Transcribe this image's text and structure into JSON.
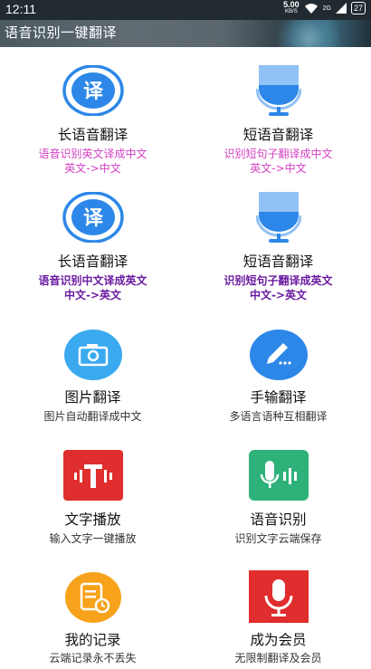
{
  "status": {
    "time": "12:11",
    "net_speed": "5.00",
    "net_unit": "KB/S",
    "sig": "2G",
    "battery": "27"
  },
  "header": {
    "title": "语音识别一键翻译"
  },
  "rows": [
    {
      "left": {
        "title": "长语音翻译",
        "line1": "语音识别英文译成中文",
        "line2": "英文->中文",
        "icon": "translate-icon"
      },
      "right": {
        "title": "短语音翻译",
        "line1": "识别短句子翻译成中文",
        "line2": "英文->中文",
        "icon": "microphone-icon"
      }
    },
    {
      "left": {
        "title": "长语音翻译",
        "line1": "语音识别中文译成英文",
        "line2": "中文->英文",
        "icon": "translate-icon"
      },
      "right": {
        "title": "短语音翻译",
        "line1": "识别短句子翻译成英文",
        "line2": "中文->英文",
        "icon": "microphone-icon"
      }
    },
    {
      "left": {
        "title": "图片翻译",
        "line1": "图片自动翻译成中文",
        "icon": "camera-icon"
      },
      "right": {
        "title": "手输翻译",
        "line1": "多语言语种互相翻译",
        "icon": "pencil-icon"
      }
    },
    {
      "left": {
        "title": "文字播放",
        "line1": "输入文字一键播放",
        "icon": "text-speech-icon"
      },
      "right": {
        "title": "语音识别",
        "line1": "识别文字云端保存",
        "icon": "voice-record-icon"
      }
    },
    {
      "left": {
        "title": "我的记录",
        "line1": "云端记录永不丢失",
        "icon": "history-icon"
      },
      "right": {
        "title": "成为会员",
        "line1": "无限制翻译及会员",
        "icon": "member-mic-icon"
      }
    }
  ],
  "colors": {
    "blue": "#2d87e8",
    "pink": "#d440c4",
    "purple": "#6a1aa0",
    "red": "#e02d2d",
    "green": "#2fb27a",
    "orange": "#f7a21b",
    "sky": "#3aa9ef"
  }
}
